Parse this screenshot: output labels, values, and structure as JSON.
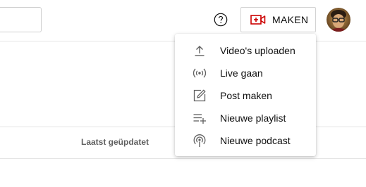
{
  "header": {
    "create_label": "MAKEN",
    "help_icon": "help-circle-icon",
    "create_icon": "video-plus-icon",
    "accent_color": "#cc0000"
  },
  "table": {
    "column_last_updated": "Laatst geüpdatet"
  },
  "create_menu": {
    "items": [
      {
        "label": "Video's uploaden",
        "icon": "upload-icon"
      },
      {
        "label": "Live gaan",
        "icon": "live-broadcast-icon"
      },
      {
        "label": "Post maken",
        "icon": "edit-post-icon"
      },
      {
        "label": "Nieuwe playlist",
        "icon": "playlist-add-icon"
      },
      {
        "label": "Nieuwe podcast",
        "icon": "podcast-icon"
      }
    ]
  }
}
